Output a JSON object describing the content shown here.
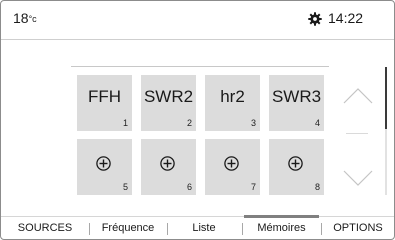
{
  "status": {
    "temperature": "18",
    "temperature_unit": "°c",
    "time": "14:22",
    "settings_icon": "gear-icon"
  },
  "presets": [
    {
      "label": "FFH",
      "number": "1"
    },
    {
      "label": "SWR2",
      "number": "2"
    },
    {
      "label": "hr2",
      "number": "3"
    },
    {
      "label": "SWR3",
      "number": "4"
    },
    {
      "label": "",
      "number": "5",
      "icon": "add-icon"
    },
    {
      "label": "",
      "number": "6",
      "icon": "add-icon"
    },
    {
      "label": "",
      "number": "7",
      "icon": "add-icon"
    },
    {
      "label": "",
      "number": "8",
      "icon": "add-icon"
    }
  ],
  "scroll": {
    "up_icon": "chevron-up-icon",
    "down_icon": "chevron-down-icon"
  },
  "tabs": {
    "sources": "SOURCES",
    "frequence": "Fréquence",
    "liste": "Liste",
    "memoires": "Mémoires",
    "options": "OPTIONS",
    "active": "Mémoires"
  },
  "colors": {
    "tile": "#dcdcdc",
    "active_tab_indicator": "#808080"
  }
}
